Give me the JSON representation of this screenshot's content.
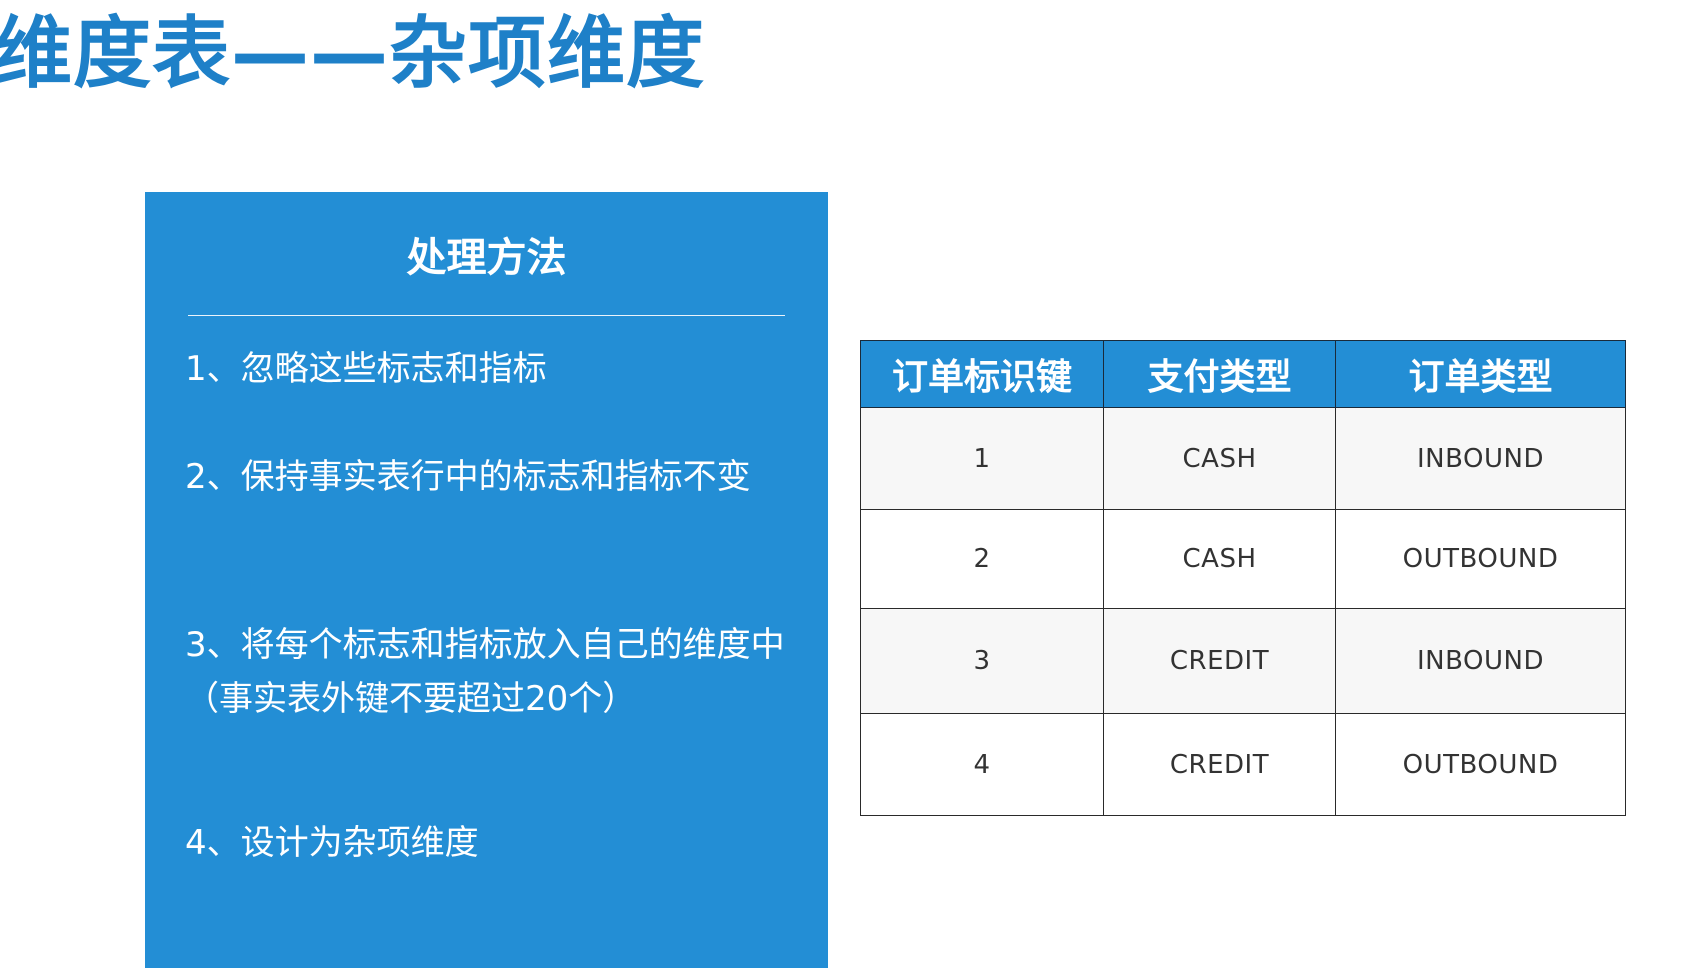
{
  "title": "维度表——杂项维度",
  "panel": {
    "heading": "处理方法",
    "items": [
      "1、忽略这些标志和指标",
      "2、保持事实表行中的标志和指标不变",
      "3、将每个标志和指标放入自己的维度中（事实表外键不要超过20个）",
      "4、设计为杂项维度"
    ]
  },
  "table": {
    "headers": [
      "订单标识键",
      "支付类型",
      "订单类型"
    ],
    "rows": [
      [
        "1",
        "CASH",
        "INBOUND"
      ],
      [
        "2",
        "CASH",
        "OUTBOUND"
      ],
      [
        "3",
        "CREDIT",
        "INBOUND"
      ],
      [
        "4",
        "CREDIT",
        "OUTBOUND"
      ]
    ]
  },
  "colors": {
    "accent": "#238ed5",
    "title": "#1e80c8",
    "row_alt": "#f7f7f7"
  }
}
